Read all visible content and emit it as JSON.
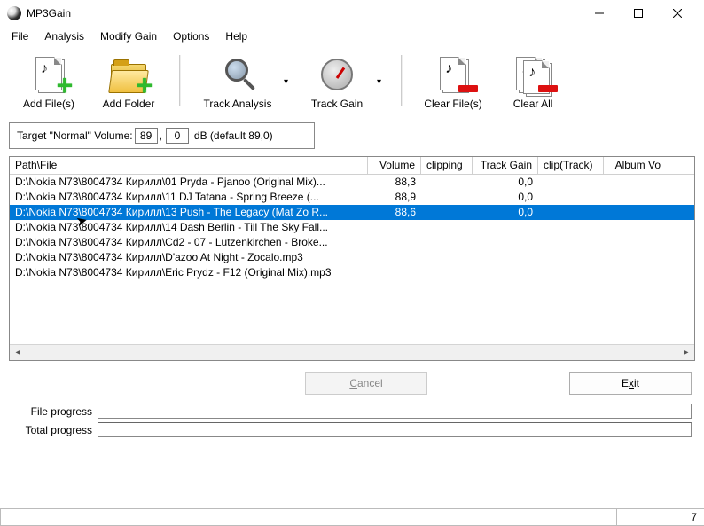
{
  "window": {
    "title": "MP3Gain"
  },
  "menu": {
    "items": [
      "File",
      "Analysis",
      "Modify Gain",
      "Options",
      "Help"
    ]
  },
  "toolbar": {
    "add_files": "Add File(s)",
    "add_folder": "Add Folder",
    "track_analysis": "Track Analysis",
    "track_gain": "Track Gain",
    "clear_files": "Clear File(s)",
    "clear_all": "Clear All"
  },
  "target": {
    "label": "Target \"Normal\" Volume:",
    "int": "89",
    "frac": "0",
    "suffix": "dB  (default 89,0)"
  },
  "grid": {
    "columns": [
      "Path\\File",
      "Volume",
      "clipping",
      "Track Gain",
      "clip(Track)",
      "Album Vo"
    ],
    "rows": [
      {
        "path": "D:\\Nokia N73\\8004734 Кирилл\\01 Pryda - Pjanoo (Original Mix)...",
        "vol": "88,3",
        "clip": "",
        "tg": "0,0",
        "ct": "",
        "selected": false
      },
      {
        "path": "D:\\Nokia N73\\8004734 Кирилл\\11 DJ Tatana - Spring Breeze (...",
        "vol": "88,9",
        "clip": "",
        "tg": "0,0",
        "ct": "",
        "selected": false
      },
      {
        "path": "D:\\Nokia N73\\8004734 Кирилл\\13 Push - The Legacy (Mat Zo R...",
        "vol": "88,6",
        "clip": "",
        "tg": "0,0",
        "ct": "",
        "selected": true
      },
      {
        "path": "D:\\Nokia N73\\8004734 Кирилл\\14 Dash Berlin - Till The Sky Fall...",
        "vol": "",
        "clip": "",
        "tg": "",
        "ct": "",
        "selected": false
      },
      {
        "path": "D:\\Nokia N73\\8004734 Кирилл\\Cd2 - 07 - Lutzenkirchen - Broke...",
        "vol": "",
        "clip": "",
        "tg": "",
        "ct": "",
        "selected": false
      },
      {
        "path": "D:\\Nokia N73\\8004734 Кирилл\\D'azoo At Night - Zocalo.mp3",
        "vol": "",
        "clip": "",
        "tg": "",
        "ct": "",
        "selected": false
      },
      {
        "path": "D:\\Nokia N73\\8004734 Кирилл\\Eric Prydz - F12 (Original Mix).mp3",
        "vol": "",
        "clip": "",
        "tg": "",
        "ct": "",
        "selected": false
      }
    ]
  },
  "buttons": {
    "cancel_prefix": "",
    "cancel_mnemonic": "C",
    "cancel_suffix": "ancel",
    "exit_prefix": "E",
    "exit_mnemonic": "x",
    "exit_suffix": "it"
  },
  "progress": {
    "file_label": "File progress",
    "total_label": "Total progress"
  },
  "status": {
    "count": "7"
  }
}
